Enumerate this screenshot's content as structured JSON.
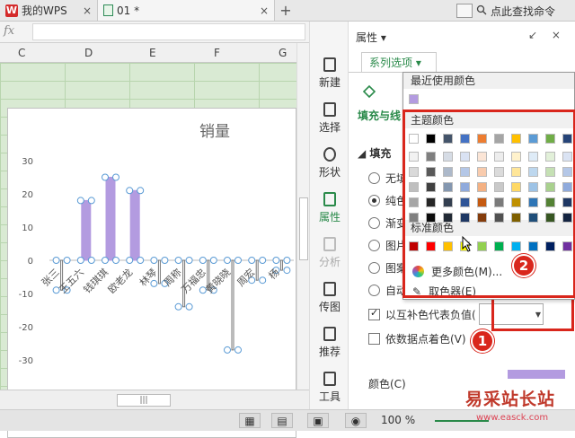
{
  "tabs": {
    "wps_label": "我的WPS",
    "doc_label": "01 *",
    "close": "×",
    "plus": "+",
    "search": "点此查找命令"
  },
  "formula_bar": {
    "fx": "fx"
  },
  "columns": [
    "C",
    "D",
    "E",
    "F",
    "G"
  ],
  "sidetools": {
    "items": [
      {
        "label": "新建"
      },
      {
        "label": "选择"
      },
      {
        "label": "形状"
      },
      {
        "label": "属性"
      },
      {
        "label": "分析"
      },
      {
        "label": "传图"
      },
      {
        "label": "推荐"
      },
      {
        "label": "工具"
      }
    ]
  },
  "panel": {
    "title": "属性 ▾",
    "controls": "↙ ×",
    "series_tab": "系列选项 ▾",
    "fill_tab": "填充与线",
    "fill_section": "◢ 填充",
    "radios": [
      {
        "label": "无填",
        "checked": false
      },
      {
        "label": "纯色",
        "checked": true
      },
      {
        "label": "渐变",
        "checked": false
      },
      {
        "label": "图片",
        "checked": false
      },
      {
        "label": "图案",
        "checked": false
      },
      {
        "label": "自动",
        "checked": false
      }
    ],
    "invert_label": "以互补色代表负值(",
    "vary_label": "依数据点着色(V)",
    "color_label": "颜色(C)"
  },
  "popup": {
    "recent_title": "最近使用颜色",
    "recent_colors": [
      "#b39be0"
    ],
    "theme_title": "主题颜色",
    "theme_row": [
      "#ffffff",
      "#000000",
      "#44546a",
      "#4472c4",
      "#ed7d31",
      "#a5a5a5",
      "#ffc000",
      "#5b9bd5",
      "#70ad47",
      "#264478"
    ],
    "theme_shades": [
      [
        "#f2f2f2",
        "#7f7f7f",
        "#d6dce5",
        "#d9e2f3",
        "#fbe5d6",
        "#ededed",
        "#fff2cc",
        "#deebf7",
        "#e2f0d9",
        "#dae3f3"
      ],
      [
        "#d9d9d9",
        "#595959",
        "#adb9ca",
        "#b4c7e7",
        "#f8cbad",
        "#dbdbdb",
        "#ffe699",
        "#bdd7ee",
        "#c5e0b4",
        "#b4c7e7"
      ],
      [
        "#bfbfbf",
        "#404040",
        "#8497b0",
        "#8faadc",
        "#f4b183",
        "#c9c9c9",
        "#ffd966",
        "#9dc3e6",
        "#a9d18e",
        "#8faadc"
      ],
      [
        "#a6a6a6",
        "#262626",
        "#333f50",
        "#2f5597",
        "#c55a11",
        "#7b7b7b",
        "#bf9000",
        "#2e75b6",
        "#548235",
        "#1f3864"
      ],
      [
        "#808080",
        "#0d0d0d",
        "#222a35",
        "#1f3864",
        "#843c0c",
        "#525252",
        "#7f6000",
        "#1f4e79",
        "#385723",
        "#142441"
      ]
    ],
    "standard_title": "标准颜色",
    "standard_colors": [
      "#c00000",
      "#ff0000",
      "#ffc000",
      "#ffff00",
      "#92d050",
      "#00b050",
      "#00b0f0",
      "#0070c0",
      "#002060",
      "#7030a0"
    ],
    "more_colors": "更多颜色(M)...",
    "eyedropper": "取色器(E)"
  },
  "badges": {
    "one": "1",
    "two": "2"
  },
  "status": {
    "zoom": "100 %"
  },
  "watermark": {
    "title": "易采站长站",
    "url": "www.easck.com"
  },
  "chart_data": {
    "type": "bar",
    "title": "销量",
    "categories": [
      "张三",
      "王五六",
      "钱琪琪",
      "欧老龙",
      "林琴",
      "周称",
      "万福忠",
      "黄晓晓",
      "周宏",
      "杨"
    ],
    "values": [
      -9,
      18,
      25,
      21,
      -7,
      -14,
      -9,
      -27,
      -6,
      -3
    ],
    "ylim": [
      -30,
      30
    ],
    "yticks": [
      30,
      20,
      10,
      0,
      -10,
      -20,
      -30
    ],
    "bar_color": "#b39be0"
  }
}
